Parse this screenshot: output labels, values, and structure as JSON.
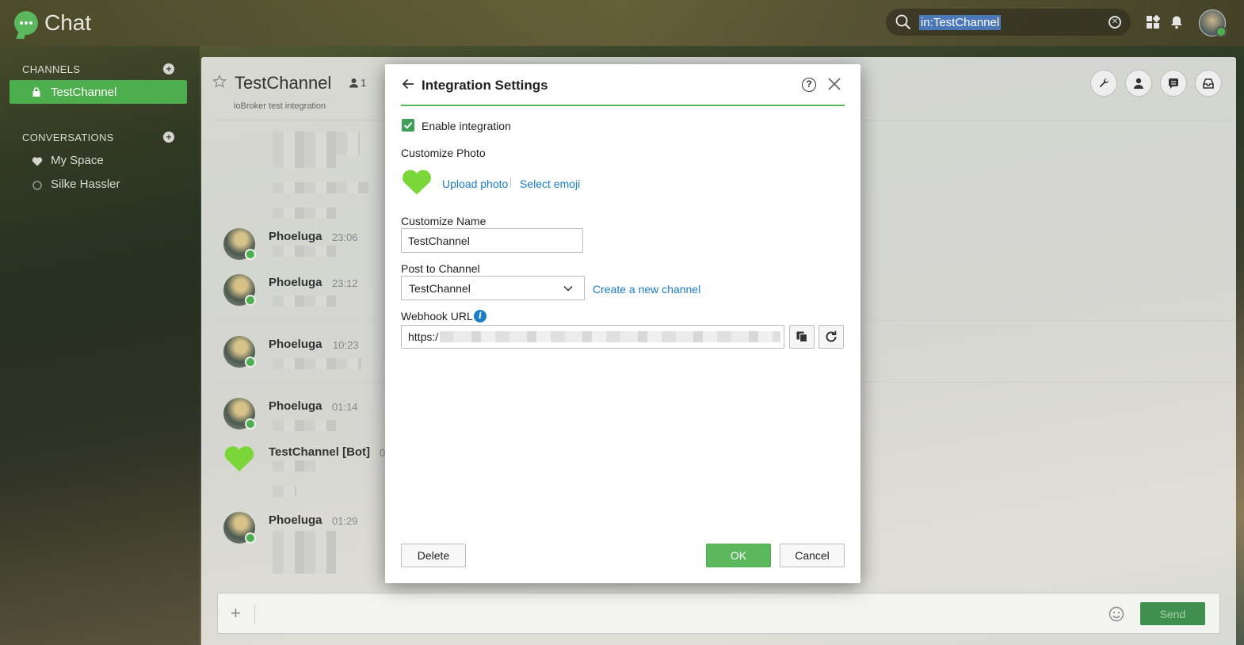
{
  "app": {
    "title": "Chat"
  },
  "search": {
    "value": "in:TestChannel"
  },
  "sidebar": {
    "channels_title": "CHANNELS",
    "channels": [
      {
        "label": "TestChannel",
        "icon": "lock-icon",
        "active": true
      }
    ],
    "conversations_title": "CONVERSATIONS",
    "conversations": [
      {
        "label": "My Space",
        "icon": "heart-icon"
      },
      {
        "label": "Silke Hassler",
        "icon": "presence-dot-icon"
      }
    ]
  },
  "channel": {
    "title": "TestChannel",
    "member_count": "1",
    "description": "ioBroker test integration"
  },
  "messages": [
    {
      "name": "Phoeluga",
      "time": "23:06"
    },
    {
      "name": "Phoeluga",
      "time": "23:12"
    },
    {
      "name": "Phoeluga",
      "time": "10:23"
    },
    {
      "name": "Phoeluga",
      "time": "01:14"
    },
    {
      "name": "TestChannel [Bot]",
      "time": "0"
    },
    {
      "name": "Phoeluga",
      "time": "01:29"
    }
  ],
  "composer": {
    "send_label": "Send"
  },
  "modal": {
    "title": "Integration Settings",
    "help_label": "?",
    "enable_label": "Enable integration",
    "enabled": true,
    "photo_section_label": "Customize Photo",
    "upload_photo_label": "Upload photo",
    "select_emoji_label": "Select emoji",
    "name_label": "Customize Name",
    "name_value": "TestChannel",
    "post_label": "Post to Channel",
    "post_value": "TestChannel",
    "create_channel_label": "Create a new channel",
    "webhook_label": "Webhook URL",
    "webhook_prefix": "https:/",
    "delete_label": "Delete",
    "ok_label": "OK",
    "cancel_label": "Cancel"
  },
  "colors": {
    "accent_green": "#5cb85c",
    "link_blue": "#1a7dc8",
    "heart_green": "#7bd63a",
    "send_button": "#3f8f4f"
  }
}
